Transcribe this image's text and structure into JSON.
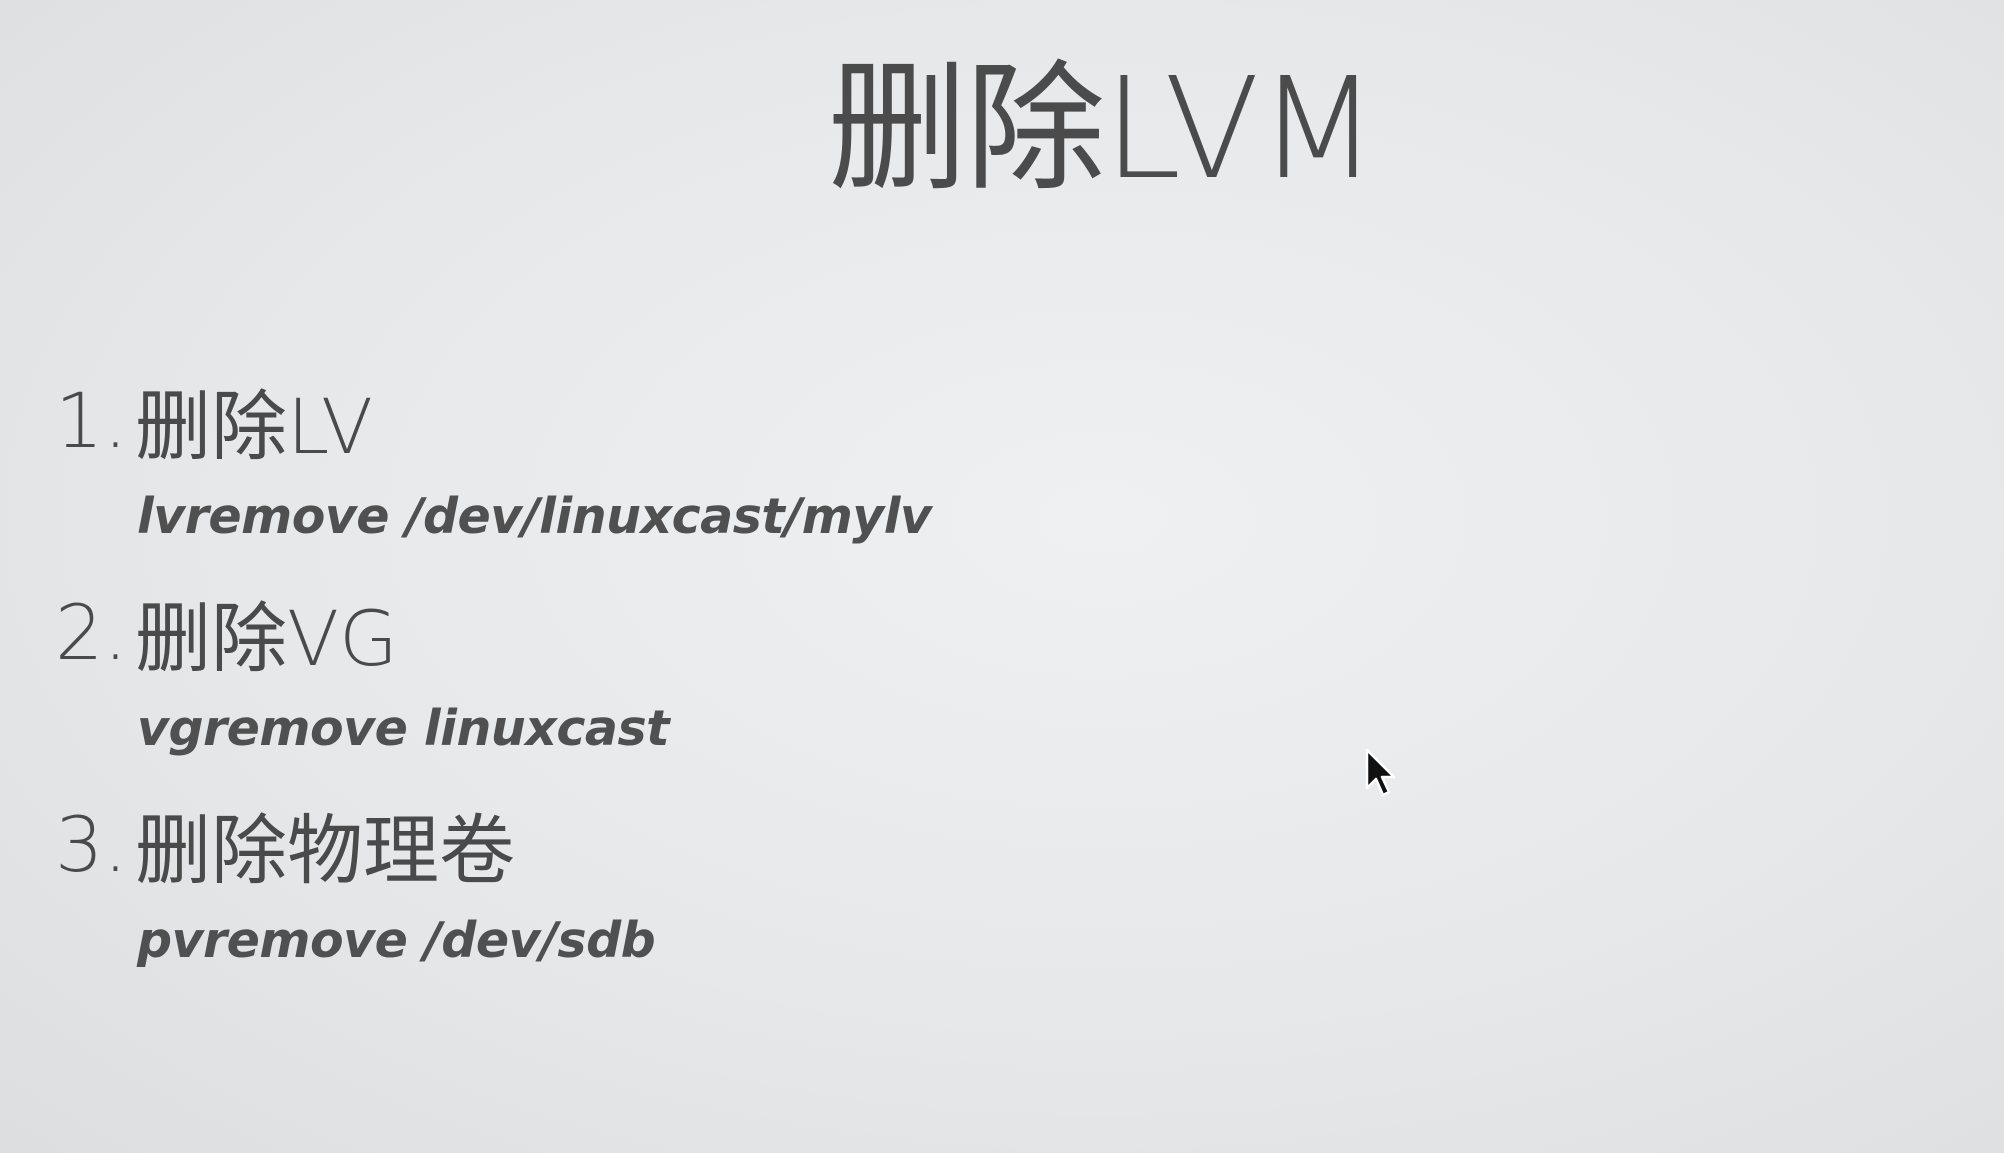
{
  "slide": {
    "title": "删除LVM",
    "steps": [
      {
        "number": "1.",
        "label": "删除LV",
        "command": "lvremove /dev/linuxcast/mylv"
      },
      {
        "number": "2.",
        "label": "删除VG",
        "command": "vgremove linuxcast"
      },
      {
        "number": "3.",
        "label": "删除物理卷",
        "command": "pvremove /dev/sdb"
      }
    ]
  },
  "cursor": {
    "icon": "arrow-pointer-icon"
  },
  "colors": {
    "background": "#e6e8ea",
    "text": "#4a4a4a"
  }
}
